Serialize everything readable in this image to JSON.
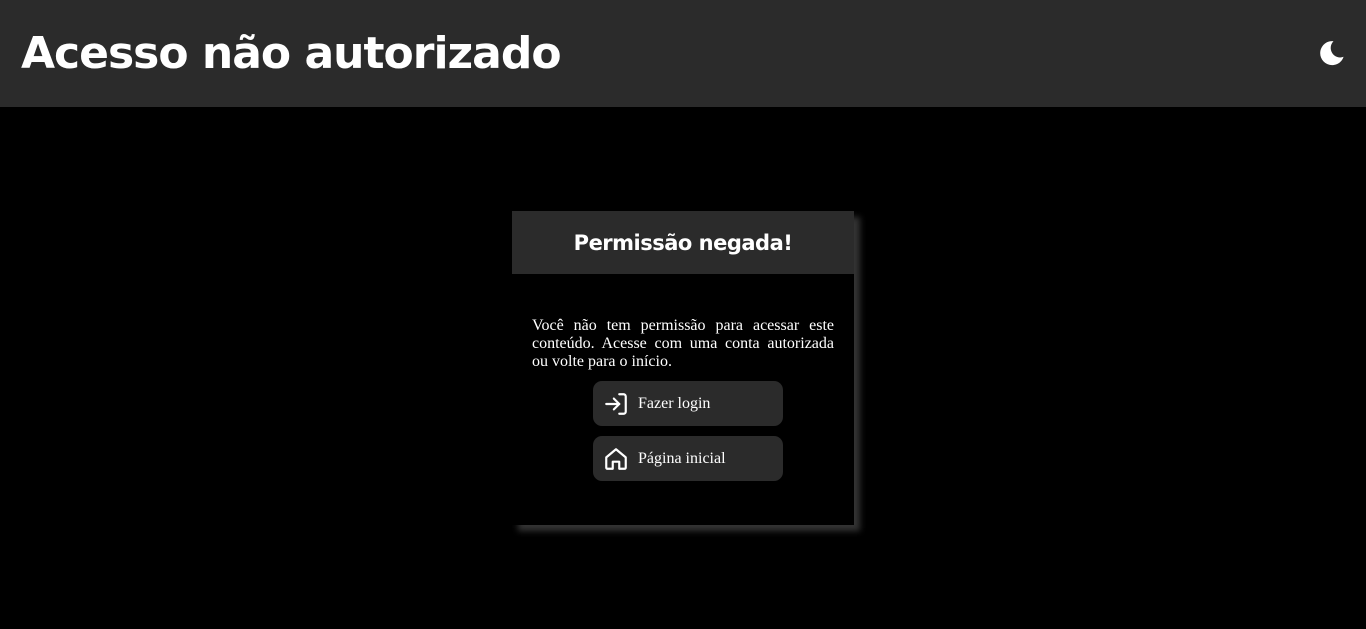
{
  "header": {
    "title": "Acesso não autorizado",
    "theme_toggle_icon": "moon-icon"
  },
  "card": {
    "title": "Permissão negada!",
    "message": "Você não tem permissão para acessar este conteúdo. Acesse com uma conta autorizada ou volte para o início.",
    "buttons": [
      {
        "label": "Fazer login",
        "icon": "login-icon"
      },
      {
        "label": "Página inicial",
        "icon": "home-icon"
      }
    ]
  },
  "colors": {
    "background": "#000000",
    "surface": "#2b2b2b",
    "text": "#ffffff"
  }
}
